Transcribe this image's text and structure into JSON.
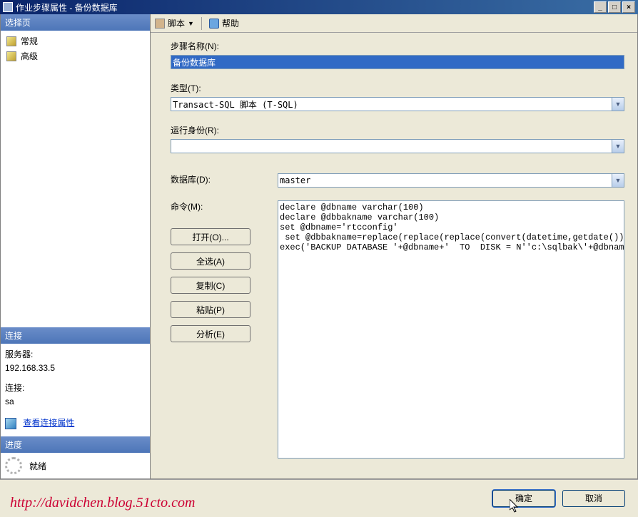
{
  "window": {
    "title": "作业步骤属性 - 备份数据库"
  },
  "winControls": {
    "min": "_",
    "max": "□",
    "close": "×"
  },
  "sidebar": {
    "selectHeader": "选择页",
    "items": [
      {
        "label": "常规"
      },
      {
        "label": "高级"
      }
    ],
    "connectionHeader": "连接",
    "connection": {
      "serverLabel": "服务器:",
      "serverValue": "192.168.33.5",
      "connLabel": "连接:",
      "connValue": "sa",
      "viewLink": "查看连接属性"
    },
    "progressHeader": "进度",
    "progressStatus": "就绪"
  },
  "toolbar": {
    "script": "脚本",
    "help": "帮助"
  },
  "form": {
    "stepNameLabel": "步骤名称(N):",
    "stepNameValue": "备份数据库",
    "typeLabel": "类型(T):",
    "typeValue": "Transact-SQL 脚本 (T-SQL)",
    "runAsLabel": "运行身份(R):",
    "runAsValue": "",
    "databaseLabel": "数据库(D):",
    "databaseValue": "master",
    "commandLabel": "命令(M):",
    "commandValue": "declare @dbname varchar(100)\ndeclare @dbbakname varchar(100)\nset @dbname='rtcconfig'\n set @dbbakname=replace(replace(replace(convert(datetime,getdate()) ,'-',''),\nexec('BACKUP DATABASE '+@dbname+'  TO  DISK = N''c:\\sqlbak\\'+@dbname+@dbbaknam",
    "buttons": {
      "open": "打开(O)...",
      "selectAll": "全选(A)",
      "copy": "复制(C)",
      "paste": "粘贴(P)",
      "parse": "分析(E)"
    }
  },
  "footer": {
    "ok": "确定",
    "cancel": "取消"
  },
  "watermark": "http://davidchen.blog.51cto.com"
}
